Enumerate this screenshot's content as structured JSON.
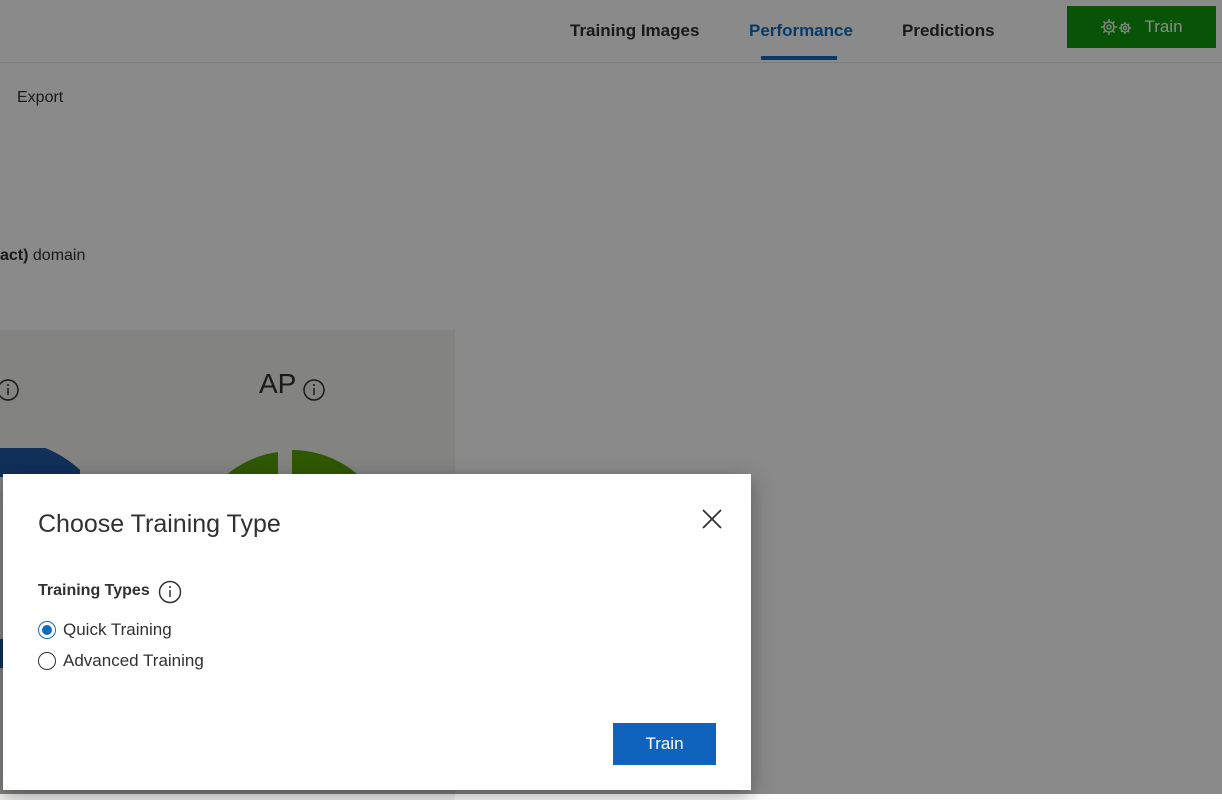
{
  "topnav": {
    "tabs": [
      {
        "label": "Training Images"
      },
      {
        "label": "Performance"
      },
      {
        "label": "Predictions"
      }
    ],
    "train_button": {
      "label": "Train",
      "icon": "gears-icon"
    }
  },
  "background": {
    "export_label": "Export",
    "domain_bold": "act)",
    "domain_rest": " domain",
    "ap_label": "AP"
  },
  "dialog": {
    "title": "Choose Training Type",
    "types_label": "Training Types",
    "options": [
      {
        "label": "Quick Training",
        "selected": true
      },
      {
        "label": "Advanced Training",
        "selected": false
      }
    ],
    "train_label": "Train"
  },
  "colors": {
    "accent": "#106ebe",
    "train_green": "#0d9b0d",
    "primary_button": "#0f63bd",
    "chart_green": "#57a300",
    "chart_blue": "#1f5aa6"
  }
}
